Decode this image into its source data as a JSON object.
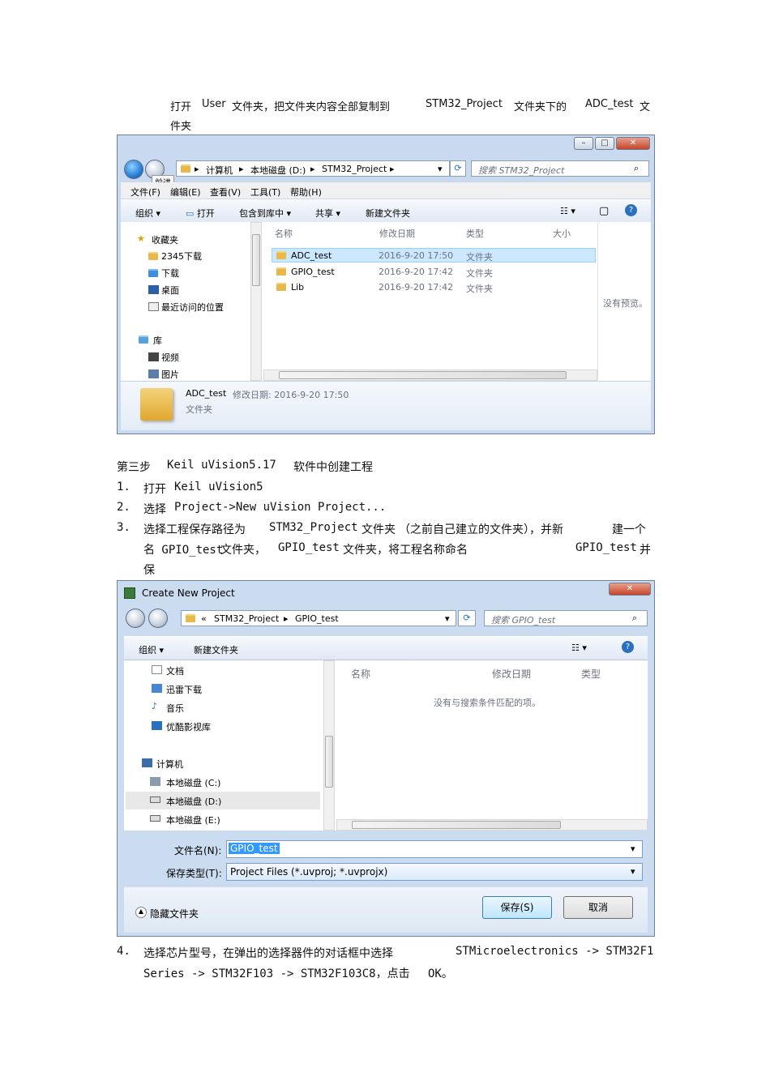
{
  "intro": {
    "line1_a": "打开",
    "line1_b": "User",
    "line1_c": "文件夹，把文件夹内容全部复制到",
    "line1_d": "STM32_Project",
    "line1_e": "文件夹下的",
    "line1_f": "ADC_test",
    "line1_g": "文",
    "line2": "件夹"
  },
  "explorer": {
    "back_tooltip": "前进",
    "breadcrumb": [
      "计算机",
      "本地磁盘 (D:)",
      "STM32_Project"
    ],
    "search_placeholder": "搜索 STM32_Project",
    "menu": [
      "文件(F)",
      "编辑(E)",
      "查看(V)",
      "工具(T)",
      "帮助(H)"
    ],
    "toolbar": [
      "组织",
      "打开",
      "包含到库中",
      "共享",
      "新建文件夹"
    ],
    "nav": {
      "favorites_label": "收藏夹",
      "favorites": [
        "2345下载",
        "下载",
        "桌面",
        "最近访问的位置"
      ],
      "library_label": "库",
      "library": [
        "视频",
        "图片"
      ]
    },
    "columns": [
      "名称",
      "修改日期",
      "类型",
      "大小"
    ],
    "rows": [
      {
        "name": "ADC_test",
        "date": "2016-9-20 17:50",
        "type": "文件夹"
      },
      {
        "name": "GPIO_test",
        "date": "2016-9-20 17:42",
        "type": "文件夹"
      },
      {
        "name": "Lib",
        "date": "2016-9-20 17:42",
        "type": "文件夹"
      }
    ],
    "preview_text": "没有预览。",
    "details": {
      "name": "ADC_test",
      "meta": "修改日期: 2016-9-20 17:50",
      "kind": "文件夹"
    }
  },
  "section": {
    "heading_a": "第三步",
    "heading_b": "Keil uVision5.17",
    "heading_c": "软件中创建工程",
    "steps": [
      {
        "num": "1.",
        "a": "打开",
        "b": "Keil uVision5"
      },
      {
        "num": "2.",
        "a": "选择",
        "b": "Project->New uVision Project..."
      },
      {
        "num": "3.",
        "a": "选择工程保存路径为",
        "b": "STM32_Project",
        "c": "文件夹",
        "d": "（之前自己建立的文件夹），并新",
        "e": "建一个"
      }
    ],
    "step3_line2_a": "名 GPIO_test",
    "step3_line2_b": "文件夹，",
    "step3_line2_c": "GPIO_test",
    "step3_line2_d": "文件夹，将工程名称命名",
    "step3_line2_e": "GPIO_test",
    "step3_line2_f": "并",
    "step3_line3": "保"
  },
  "dialog": {
    "title": "Create New Project",
    "breadcrumb": [
      "STM32_Project",
      "GPIO_test"
    ],
    "search_placeholder": "搜索 GPIO_test",
    "toolbar": [
      "组织",
      "新建文件夹"
    ],
    "nav": [
      "文档",
      "迅雷下载",
      "音乐",
      "优酷影视库",
      "计算机",
      "本地磁盘 (C:)",
      "本地磁盘 (D:)",
      "本地磁盘 (E:)"
    ],
    "columns": [
      "名称",
      "修改日期",
      "类型"
    ],
    "empty_text": "没有与搜索条件匹配的项。",
    "filename_label": "文件名(N):",
    "filename_value": "GPIO_test",
    "filetype_label": "保存类型(T):",
    "filetype_value": "Project Files (*.uvproj; *.uvprojx)",
    "hide_folders": "隐藏文件夹",
    "save_label": "保存(S)",
    "cancel_label": "取消"
  },
  "step4": {
    "num": "4.",
    "a": "选择芯片型号，在弹出的选择器件的对话框中选择",
    "b": "STMicroelectronics -> STM32F1",
    "line2": "Series -> STM32F103 -> STM32F103C8，点击",
    "ok": "OK。"
  }
}
